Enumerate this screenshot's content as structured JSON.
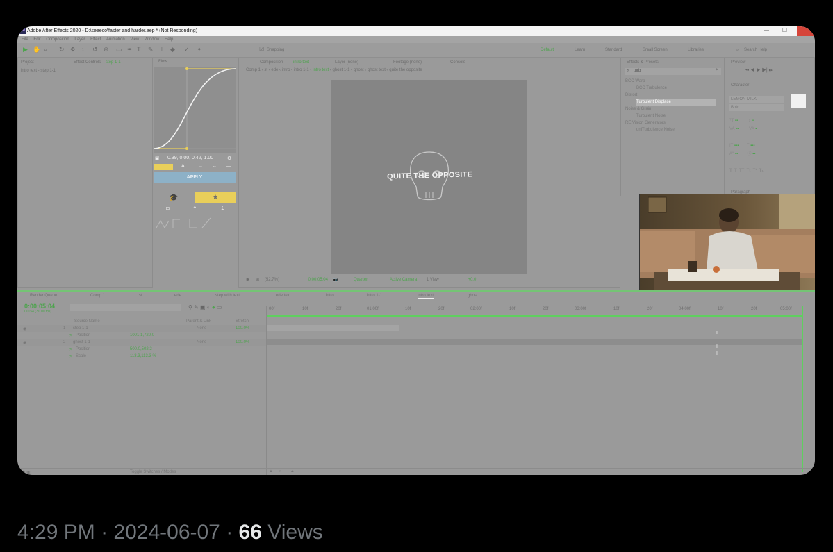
{
  "window": {
    "title": "Adobe After Effects 2020 - D:\\seeeco\\faster and harder.aep * (Not Responding)"
  },
  "menu": [
    "File",
    "Edit",
    "Composition",
    "Layer",
    "Effect",
    "Animation",
    "View",
    "Window",
    "Help"
  ],
  "toolbar": {
    "snapping": "Snapping",
    "workspaces": [
      "Default",
      "Learn",
      "Standard",
      "Small Screen",
      "Libraries"
    ],
    "search": "Search Help"
  },
  "panels": {
    "project": "Project",
    "effect_controls": "Effect Controls",
    "effect_layer": "step 1-1",
    "effect_sub": "intro text - step 1-1",
    "flow": "Flow",
    "flow_values": "0.39, 0.00, 0.42, 1.00",
    "apply": "APPLY",
    "composition": "Composition",
    "comp_name": "intro text",
    "layer_none": "Layer (none)",
    "footage_none": "Footage (none)",
    "console": "Console",
    "comp_breadcrumb": [
      "Comp 1",
      "st",
      "ede",
      "intro",
      "intro 1-1",
      "intro text",
      "ghost 1-1",
      "ghost",
      "ghost text",
      "quite the opposite"
    ],
    "comp_text": "QUITE THE OPPOSITE",
    "zoom": "(52.7%)",
    "timecode_small": "0:00:05:04",
    "resolution": "Quarter",
    "camera": "Active Camera",
    "views": "1 View",
    "exposure": "+0.0",
    "effects_presets": "Effects & Presets",
    "ep_search": "turb",
    "ep_items": [
      "BCC Warp",
      "BCC Turbulence",
      "Distort",
      "Turbulent Displace",
      "Noise & Grain",
      "Turbulent Noise",
      "RE:Vision Generators",
      "uniTurbulence Noise"
    ],
    "preview": "Preview",
    "character": "Character",
    "font": "LEMON MILK",
    "font_style": "Bold",
    "paragraph": "Paragraph"
  },
  "timeline": {
    "tabs": [
      "Render Queue",
      "Comp 1",
      "st",
      "ede",
      "step with text",
      "ede text",
      "intro",
      "intro 1-1",
      "intro text",
      "ghost"
    ],
    "timecode": "0:00:05:04",
    "fps": "00154 (30.00 fps)",
    "columns": [
      "Source Name",
      "Parent & Link",
      "Stretch"
    ],
    "layers": [
      {
        "num": "1",
        "name": "step 1-1",
        "parent": "None",
        "stretch": "100.0%"
      },
      {
        "num": "",
        "name": "Position",
        "value": "1001.1,720.0"
      },
      {
        "num": "2",
        "name": "ghost 1-1",
        "parent": "None",
        "stretch": "100.0%"
      },
      {
        "num": "",
        "name": "Position",
        "value": "500.0,502.2"
      },
      {
        "num": "",
        "name": "Scale",
        "value": "113.3,113.3 %"
      }
    ],
    "ruler": [
      "00f",
      "10f",
      "20f",
      "01:00f",
      "10f",
      "20f",
      "02:00f",
      "10f",
      "20f",
      "03:00f",
      "10f",
      "20f",
      "04:00f",
      "10f",
      "20f",
      "05:00f"
    ],
    "toggle": "Toggle Switches / Modes"
  },
  "tweet": {
    "time": "4:29 PM",
    "date": "2024-06-07",
    "views_count": "66",
    "views_label": "Views"
  }
}
